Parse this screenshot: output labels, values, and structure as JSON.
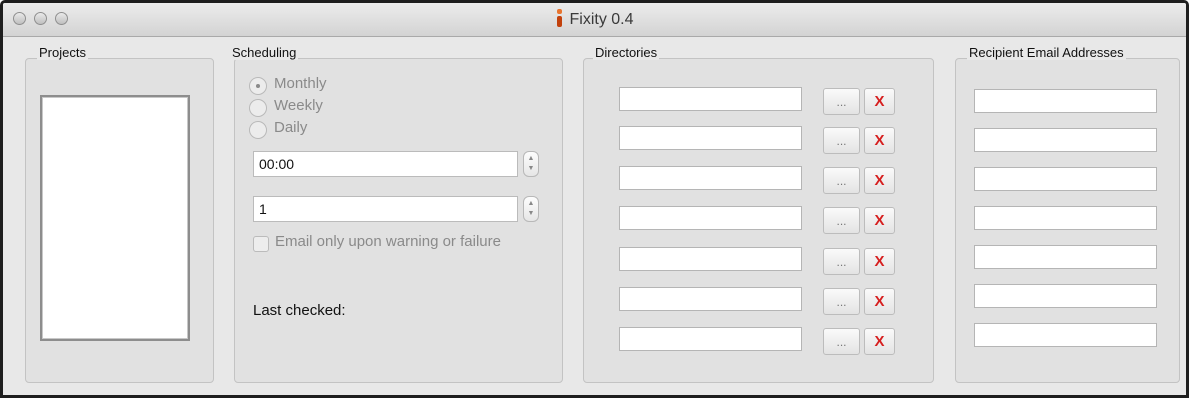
{
  "window": {
    "title": "Fixity 0.4",
    "app_icon_colors": [
      "#e8742e",
      "#c2410c"
    ]
  },
  "projects": {
    "label": "Projects",
    "items": []
  },
  "scheduling": {
    "label": "Scheduling",
    "frequency_options": [
      "Monthly",
      "Weekly",
      "Daily"
    ],
    "selected_frequency": "Monthly",
    "time_value": "00:00",
    "day_value": "1",
    "email_only_label": "Email only upon warning or failure",
    "email_only_checked": false,
    "last_checked_label": "Last checked:"
  },
  "directories": {
    "label": "Directories",
    "browse_label": "...",
    "remove_label": "X",
    "remove_color": "#d62020",
    "paths": [
      "",
      "",
      "",
      "",
      "",
      "",
      ""
    ]
  },
  "recipients": {
    "label": "Recipient Email Addresses",
    "emails": [
      "",
      "",
      "",
      "",
      "",
      "",
      ""
    ]
  }
}
